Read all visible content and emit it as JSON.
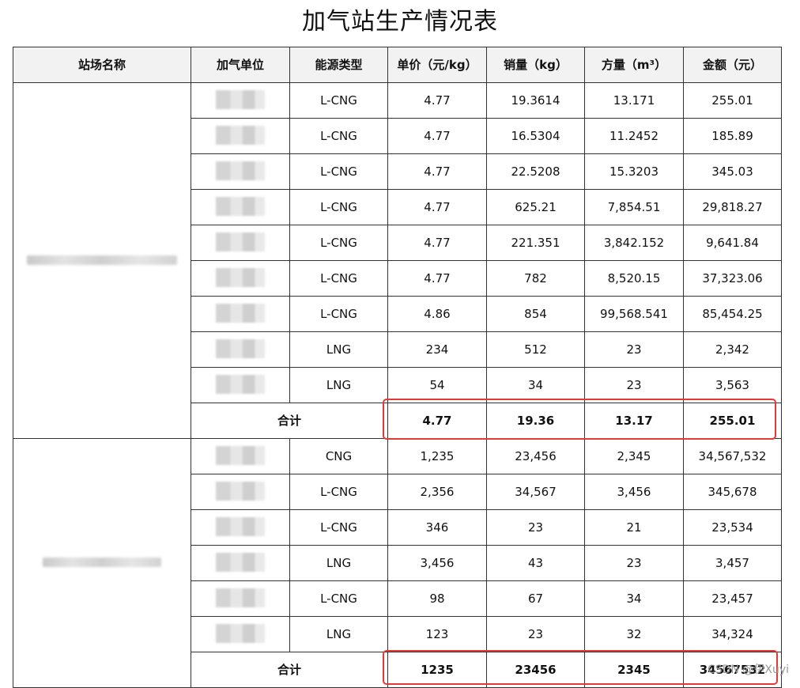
{
  "title": "加气站生产情况表",
  "headers": [
    "站场名称",
    "加气单位",
    "能源类型",
    "单价（元/kg）",
    "销量（kg）",
    "方量（m³）",
    "金额（元）"
  ],
  "groups": [
    {
      "rows": [
        {
          "energy": "L-CNG",
          "price": "4.77",
          "sales": "19.3614",
          "volume": "13.171",
          "amount": "255.01"
        },
        {
          "energy": "L-CNG",
          "price": "4.77",
          "sales": "16.5304",
          "volume": "11.2452",
          "amount": "185.89"
        },
        {
          "energy": "L-CNG",
          "price": "4.77",
          "sales": "22.5208",
          "volume": "15.3203",
          "amount": "345.03"
        },
        {
          "energy": "L-CNG",
          "price": "4.77",
          "sales": "625.21",
          "volume": "7,854.51",
          "amount": "29,818.27"
        },
        {
          "energy": "L-CNG",
          "price": "4.77",
          "sales": "221.351",
          "volume": "3,842.152",
          "amount": "9,641.84"
        },
        {
          "energy": "L-CNG",
          "price": "4.77",
          "sales": "782",
          "volume": "8,520.15",
          "amount": "37,323.06"
        },
        {
          "energy": "L-CNG",
          "price": "4.86",
          "sales": "854",
          "volume": "99,568.541",
          "amount": "85,454.25"
        },
        {
          "energy": "LNG",
          "price": "234",
          "sales": "512",
          "volume": "23",
          "amount": "2,342"
        },
        {
          "energy": "LNG",
          "price": "54",
          "sales": "34",
          "volume": "23",
          "amount": "3,563"
        }
      ],
      "total": {
        "label": "合计",
        "price": "4.77",
        "sales": "19.36",
        "volume": "13.17",
        "amount": "255.01"
      }
    },
    {
      "rows": [
        {
          "energy": "CNG",
          "price": "1,235",
          "sales": "23,456",
          "volume": "2,345",
          "amount": "34,567,532"
        },
        {
          "energy": "L-CNG",
          "price": "2,356",
          "sales": "34,567",
          "volume": "3,456",
          "amount": "345,678"
        },
        {
          "energy": "L-CNG",
          "price": "346",
          "sales": "23",
          "volume": "21",
          "amount": "23,534"
        },
        {
          "energy": "LNG",
          "price": "3,456",
          "sales": "43",
          "volume": "23",
          "amount": "3,457"
        },
        {
          "energy": "L-CNG",
          "price": "98",
          "sales": "67",
          "volume": "34",
          "amount": "23,457"
        },
        {
          "energy": "LNG",
          "price": "123",
          "sales": "23",
          "volume": "32",
          "amount": "34,324"
        }
      ],
      "total": {
        "label": "合计",
        "price": "1235",
        "sales": "23456",
        "volume": "2345",
        "amount": "34567532"
      }
    }
  ],
  "watermark": "CSDN @伊Xuyi",
  "highlight_color": "#e53935"
}
